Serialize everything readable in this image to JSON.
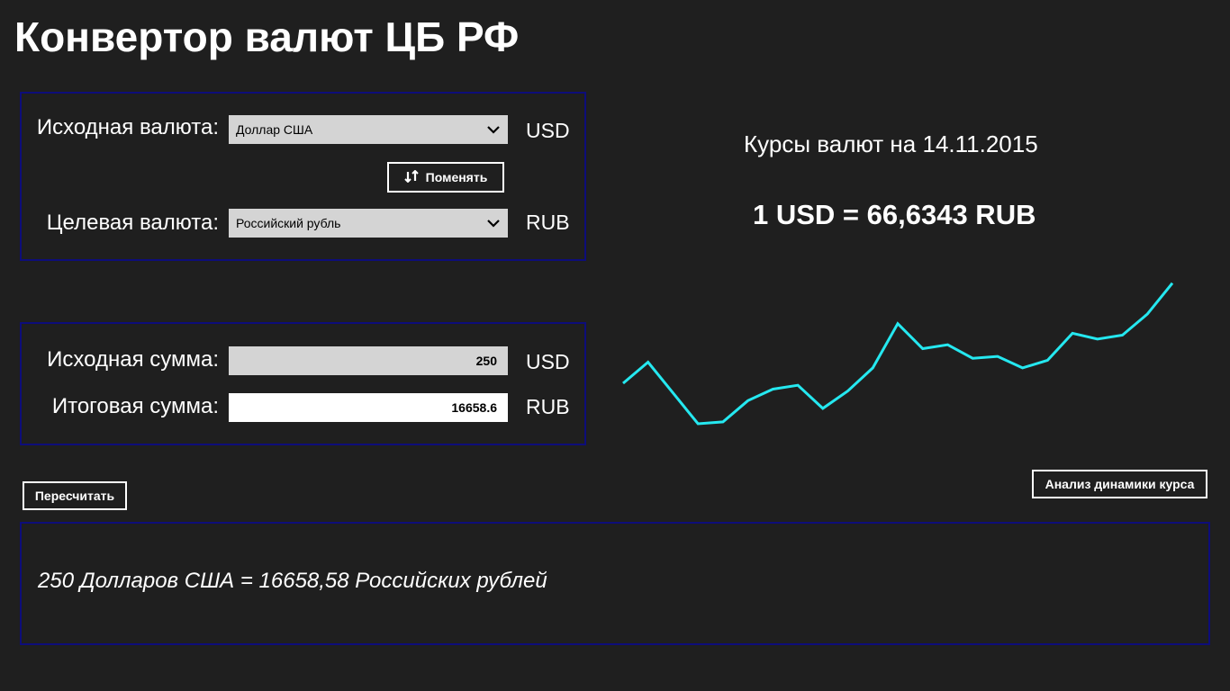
{
  "app": {
    "title": "Конвертор валют ЦБ РФ"
  },
  "currency": {
    "source_label": "Исходная валюта:",
    "source_value": "Доллар США",
    "source_code": "USD",
    "swap_label": "Поменять",
    "swap_icon": "swap-arrows-icon",
    "target_label": "Целевая  валюта:",
    "target_value": "Российский рубль",
    "target_code": "RUB"
  },
  "amount": {
    "source_label": "Исходная сумма:",
    "source_value": "250",
    "source_code": "USD",
    "result_label": "Итоговая сумма:",
    "result_value": "16658.6",
    "result_code": "RUB"
  },
  "buttons": {
    "recalc": "Пересчитать",
    "analysis": "Анализ динамики курса"
  },
  "rate": {
    "date_text": "Курсы валют на 14.11.2015",
    "value_text": "1 USD = 66,6343 RUB"
  },
  "result": {
    "text": "250 Долларов США = 16658,58 Российских рублей"
  },
  "colors": {
    "background": "#1f1f1f",
    "panel_border": "#0d0d7a",
    "chart_line": "#25e8f0",
    "field_grey": "#d4d4d4"
  },
  "chart_data": {
    "type": "line",
    "title": "",
    "xlabel": "",
    "ylabel": "",
    "grid": false,
    "values": [
      63.3,
      64.4,
      62.8,
      61.2,
      61.3,
      62.4,
      63.0,
      63.2,
      62.0,
      62.9,
      64.1,
      66.4,
      65.1,
      65.3,
      64.6,
      64.7,
      64.1,
      64.5,
      65.9,
      65.6,
      65.8,
      66.9,
      68.5
    ],
    "ylim": [
      60.5,
      69.0
    ]
  }
}
